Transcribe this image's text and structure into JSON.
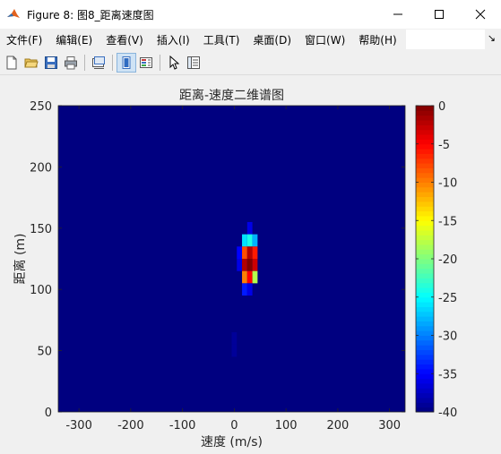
{
  "window": {
    "title": "Figure 8: 图8_距离速度图",
    "controls": [
      "minimize-icon",
      "maximize-icon",
      "close-icon"
    ]
  },
  "menu": {
    "items": [
      "文件(F)",
      "编辑(E)",
      "查看(V)",
      "插入(I)",
      "工具(T)",
      "桌面(D)",
      "窗口(W)",
      "帮助(H)"
    ],
    "overflow_icon": "menu-overflow-arrow-icon"
  },
  "toolbar": {
    "icons": [
      "new-figure-icon",
      "open-file-icon",
      "save-icon",
      "print-icon",
      "link-plot-icon",
      "hide-plot-tools-icon",
      "insert-colorbar-icon",
      "pointer-icon",
      "edit-plot-icon"
    ]
  },
  "chart_data": {
    "type": "heatmap",
    "title": "距离-速度二维谱图",
    "xlabel": "速度 (m/s)",
    "ylabel": "距离 (m)",
    "xlim": [
      -340,
      330
    ],
    "ylim": [
      0,
      250
    ],
    "xticks": [
      -300,
      -200,
      -100,
      0,
      100,
      200,
      300
    ],
    "yticks": [
      0,
      50,
      100,
      150,
      200,
      250
    ],
    "colorbar": {
      "clim": [
        -40,
        0
      ],
      "ticks": [
        0,
        -5,
        -10,
        -15,
        -20,
        -25,
        -30,
        -35,
        -40
      ],
      "colormap": "jet"
    },
    "background_value": -40,
    "cell_size": {
      "dx": 10,
      "dy": 10
    },
    "cells": [
      {
        "x": 30,
        "y": 150,
        "v": -36
      },
      {
        "x": 20,
        "y": 140,
        "v": -26
      },
      {
        "x": 30,
        "y": 140,
        "v": -24
      },
      {
        "x": 40,
        "y": 140,
        "v": -28
      },
      {
        "x": 10,
        "y": 130,
        "v": -35
      },
      {
        "x": 20,
        "y": 130,
        "v": -8
      },
      {
        "x": 30,
        "y": 130,
        "v": -2
      },
      {
        "x": 40,
        "y": 130,
        "v": -6
      },
      {
        "x": 10,
        "y": 120,
        "v": -36
      },
      {
        "x": 20,
        "y": 120,
        "v": -2
      },
      {
        "x": 30,
        "y": 120,
        "v": 0
      },
      {
        "x": 40,
        "y": 120,
        "v": -3
      },
      {
        "x": 20,
        "y": 110,
        "v": -10
      },
      {
        "x": 30,
        "y": 110,
        "v": -5
      },
      {
        "x": 40,
        "y": 110,
        "v": -18
      },
      {
        "x": 20,
        "y": 100,
        "v": -34
      },
      {
        "x": 30,
        "y": 100,
        "v": -36
      },
      {
        "x": 0,
        "y": 60,
        "v": -39
      },
      {
        "x": 0,
        "y": 50,
        "v": -39
      }
    ]
  }
}
